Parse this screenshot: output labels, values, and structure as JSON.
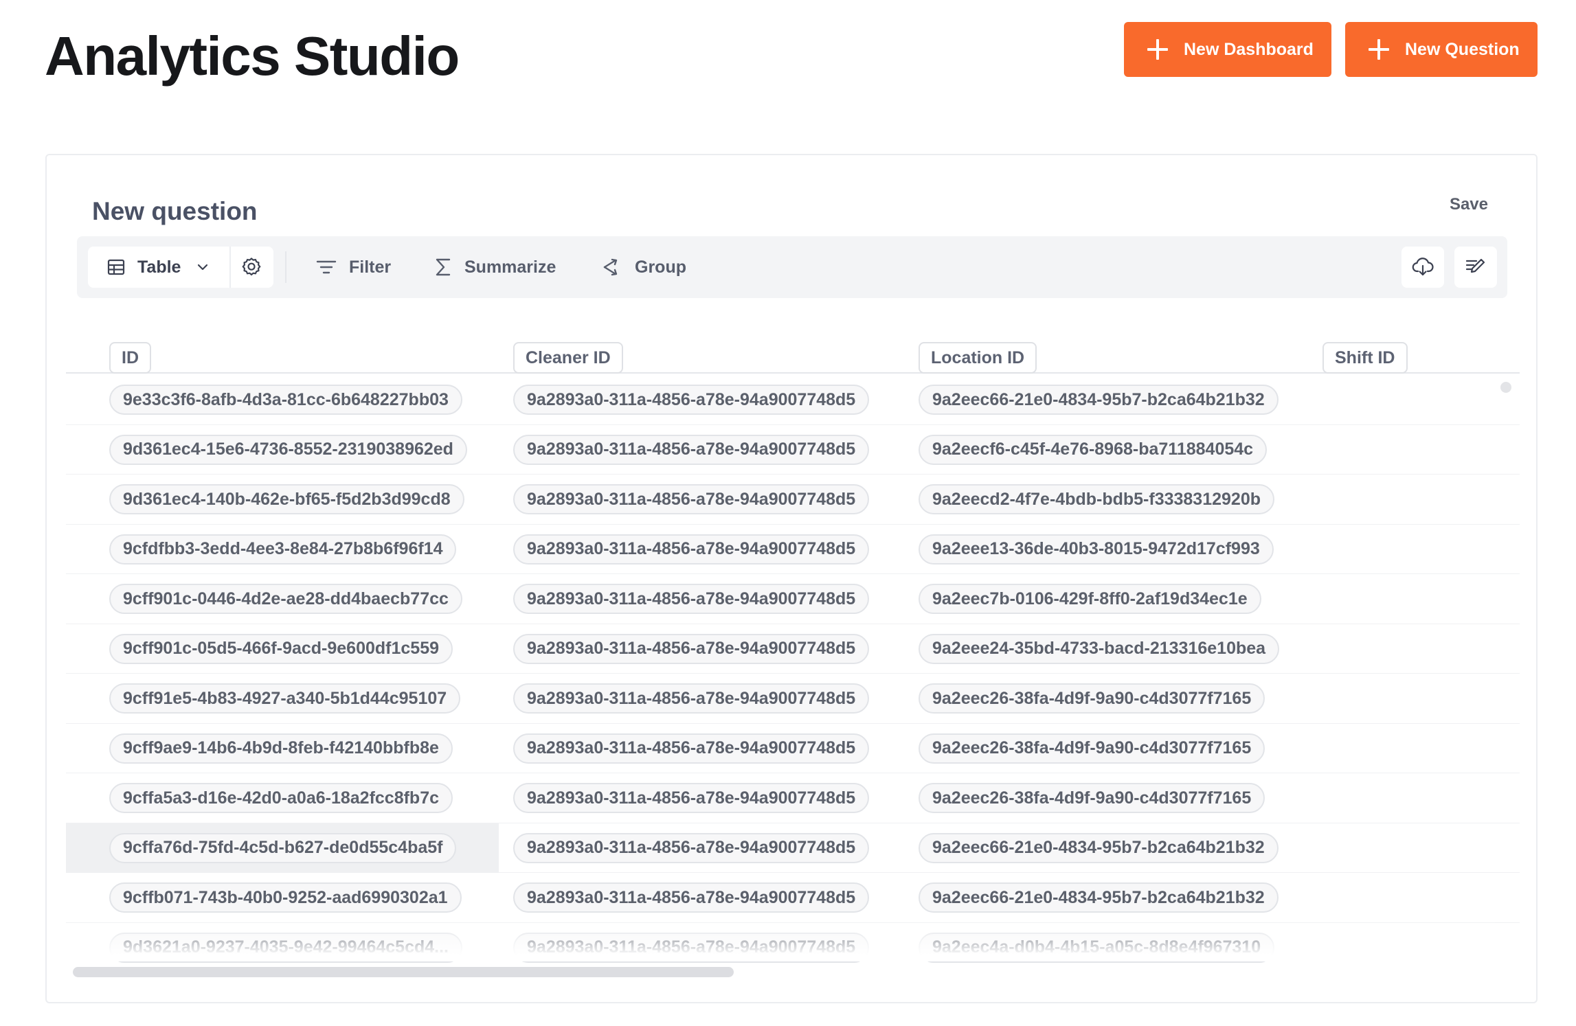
{
  "header": {
    "title": "Analytics Studio",
    "new_dashboard_label": "New Dashboard",
    "new_question_label": "New Question"
  },
  "question": {
    "title": "New question",
    "save_label": "Save"
  },
  "toolbar": {
    "viz_label": "Table",
    "filter_label": "Filter",
    "summarize_label": "Summarize",
    "group_label": "Group"
  },
  "table": {
    "columns": [
      "ID",
      "Cleaner ID",
      "Location ID",
      "Shift ID"
    ],
    "rows": [
      [
        "9e33c3f6-8afb-4d3a-81cc-6b648227bb03",
        "9a2893a0-311a-4856-a78e-94a9007748d5",
        "9a2eec66-21e0-4834-95b7-b2ca64b21b32"
      ],
      [
        "9d361ec4-15e6-4736-8552-2319038962ed",
        "9a2893a0-311a-4856-a78e-94a9007748d5",
        "9a2eecf6-c45f-4e76-8968-ba711884054c"
      ],
      [
        "9d361ec4-140b-462e-bf65-f5d2b3d99cd8",
        "9a2893a0-311a-4856-a78e-94a9007748d5",
        "9a2eecd2-4f7e-4bdb-bdb5-f3338312920b"
      ],
      [
        "9cfdfbb3-3edd-4ee3-8e84-27b8b6f96f14",
        "9a2893a0-311a-4856-a78e-94a9007748d5",
        "9a2eee13-36de-40b3-8015-9472d17cf993"
      ],
      [
        "9cff901c-0446-4d2e-ae28-dd4baecb77cc",
        "9a2893a0-311a-4856-a78e-94a9007748d5",
        "9a2eec7b-0106-429f-8ff0-2af19d34ec1e"
      ],
      [
        "9cff901c-05d5-466f-9acd-9e600df1c559",
        "9a2893a0-311a-4856-a78e-94a9007748d5",
        "9a2eee24-35bd-4733-bacd-213316e10bea"
      ],
      [
        "9cff91e5-4b83-4927-a340-5b1d44c95107",
        "9a2893a0-311a-4856-a78e-94a9007748d5",
        "9a2eec26-38fa-4d9f-9a90-c4d3077f7165"
      ],
      [
        "9cff9ae9-14b6-4b9d-8feb-f42140bbfb8e",
        "9a2893a0-311a-4856-a78e-94a9007748d5",
        "9a2eec26-38fa-4d9f-9a90-c4d3077f7165"
      ],
      [
        "9cffa5a3-d16e-42d0-a0a6-18a2fcc8fb7c",
        "9a2893a0-311a-4856-a78e-94a9007748d5",
        "9a2eec26-38fa-4d9f-9a90-c4d3077f7165"
      ],
      [
        "9cffa76d-75fd-4c5d-b627-de0d55c4ba5f",
        "9a2893a0-311a-4856-a78e-94a9007748d5",
        "9a2eec66-21e0-4834-95b7-b2ca64b21b32"
      ],
      [
        "9cffb071-743b-40b0-9252-aad6990302a1",
        "9a2893a0-311a-4856-a78e-94a9007748d5",
        "9a2eec66-21e0-4834-95b7-b2ca64b21b32"
      ],
      [
        "9d3621a0-9237-4035-9e42-99464c5cd4...",
        "9a2893a0-311a-4856-a78e-94a9007748d5",
        "9a2eec4a-d0b4-4b15-a05c-8d8e4f967310"
      ]
    ]
  },
  "icons": {
    "plus": "plus-icon",
    "table": "table-icon",
    "chevron": "chevron-down-icon",
    "settings": "gear-icon",
    "filter": "filter-icon",
    "summarize": "sigma-icon",
    "group": "group-icon",
    "download": "cloud-download-icon",
    "editor": "edit-icon"
  },
  "colors": {
    "accent": "#f96a2c",
    "toolbar_bg": "#f3f4f6",
    "pill_bg": "#f7f7f8",
    "title_text": "#17181b"
  }
}
